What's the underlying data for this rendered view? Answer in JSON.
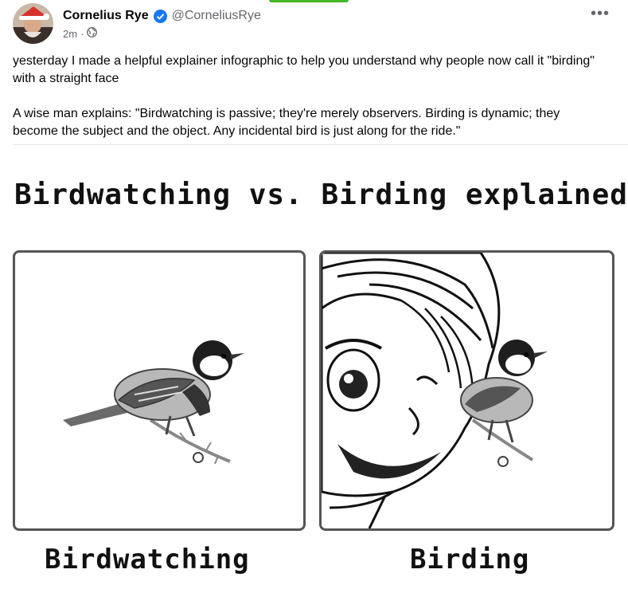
{
  "post": {
    "author_name": "Cornelius Rye",
    "author_handle": "@CorneliusRye",
    "timestamp": "2m",
    "separator": "·",
    "privacy_icon": "globe-icon",
    "verified_icon": "verified-badge-icon",
    "more_icon": "more-options-icon",
    "paragraphs": [
      "yesterday I made a helpful explainer infographic to help you understand why people now call it \"birding\" with a straight face",
      "A wise man explains: \"Birdwatching is passive; they're merely observers. Birding is dynamic; they become the subject and the object. Any incidental bird is just along for the ride.\""
    ]
  },
  "meme": {
    "title": "Birdwatching vs. Birding explained",
    "left_caption": "Birdwatching",
    "right_caption": "Birding"
  },
  "colors": {
    "verified_blue": "#1877f2",
    "secondary_text": "#65676b",
    "accent_green": "#42b72a"
  }
}
